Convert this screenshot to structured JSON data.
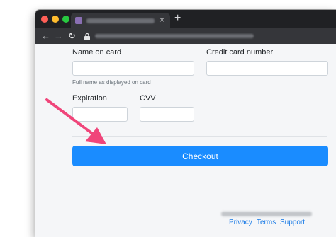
{
  "browser": {
    "tab_close_glyph": "×",
    "new_tab_glyph": "+",
    "back_glyph": "←",
    "forward_glyph": "→",
    "reload_glyph": "↻"
  },
  "form": {
    "name_label": "Name on card",
    "name_value": "",
    "name_help": "Full name as displayed on card",
    "number_label": "Credit card number",
    "number_value": "",
    "expiration_label": "Expiration",
    "expiration_value": "",
    "cvv_label": "CVV",
    "cvv_value": ""
  },
  "checkout_label": "Checkout",
  "footer": {
    "privacy": "Privacy",
    "terms": "Terms",
    "support": "Support"
  },
  "colors": {
    "accent": "#1a8cff",
    "annotation_arrow": "#f0457a"
  },
  "icons": [
    "back-arrow-icon",
    "forward-arrow-icon",
    "reload-icon",
    "lock-icon",
    "close-icon",
    "plus-icon"
  ]
}
